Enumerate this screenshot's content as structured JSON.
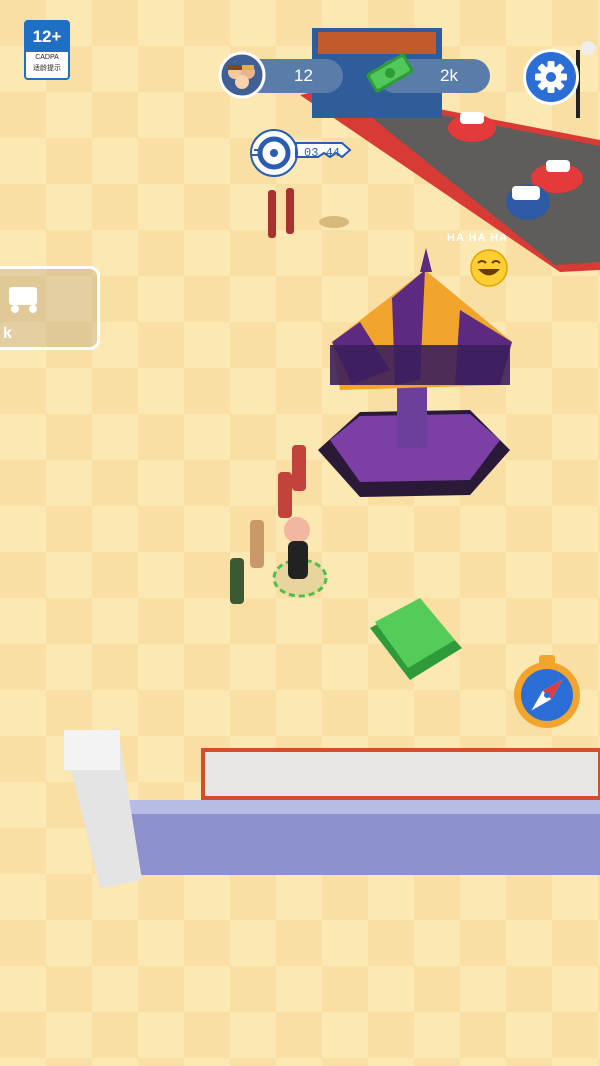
{
  "age_rating": {
    "age": "12+",
    "org": "CADPA",
    "note": "适龄提示"
  },
  "hud": {
    "visitors_count": "12",
    "money_amount": "2k"
  },
  "key_timer": {
    "time": "03 44"
  },
  "ticket_sign": {
    "price": "k"
  },
  "laugh_bubble": {
    "text": "HA HA HA"
  },
  "colors": {
    "floor": "#f9dfa4",
    "hud_pill": "#5a7ca8",
    "settings_button": "#2b6fd6",
    "carousel_purple": "#5d2a82",
    "carousel_orange": "#f2a52c",
    "cash_green": "#3fb94a"
  },
  "icons": [
    "visitors-icon",
    "cash-icon",
    "gear-icon",
    "key-icon",
    "tire-icon",
    "compass-icon",
    "laugh-emoji-icon"
  ]
}
